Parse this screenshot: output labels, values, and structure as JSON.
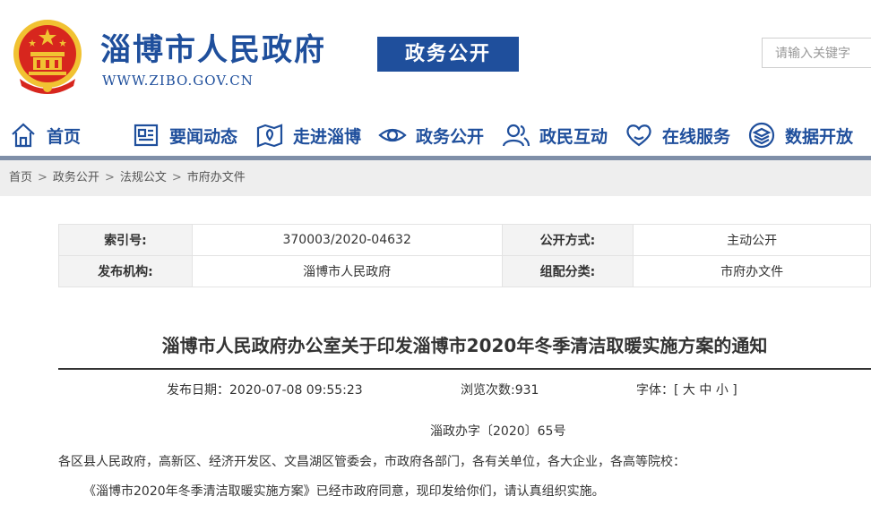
{
  "site": {
    "title": "淄博市人民政府",
    "url": "WWW.ZIBO.GOV.CN",
    "badge": "政务公开",
    "search_placeholder": "请输入关键字"
  },
  "nav": [
    {
      "label": "首页",
      "icon": "home-icon"
    },
    {
      "label": "要闻动态",
      "icon": "news-icon"
    },
    {
      "label": "走进淄博",
      "icon": "map-pin-icon"
    },
    {
      "label": "政务公开",
      "icon": "eye-icon"
    },
    {
      "label": "政民互动",
      "icon": "people-icon"
    },
    {
      "label": "在线服务",
      "icon": "heart-icon"
    },
    {
      "label": "数据开放",
      "icon": "layers-icon"
    }
  ],
  "breadcrumb": [
    "首页",
    "政务公开",
    "法规公文",
    "市府办文件"
  ],
  "meta": {
    "index_label": "索引号:",
    "index_value": "370003/2020-04632",
    "publish_mode_label": "公开方式:",
    "publish_mode_value": "主动公开",
    "issuer_label": "发布机构:",
    "issuer_value": "淄博市人民政府",
    "category_label": "组配分类:",
    "category_value": "市府办文件"
  },
  "article": {
    "title": "淄博市人民政府办公室关于印发淄博市2020年冬季清洁取暖实施方案的通知",
    "publish_date": "发布日期：2020-07-08 09:55:23",
    "views": "浏览次数:931",
    "font_label": "字体：[",
    "font_large": "大",
    "font_medium": "中",
    "font_small": "小",
    "font_close": "]",
    "doc_number": "淄政办字〔2020〕65号",
    "recipients": "各区县人民政府，高新区、经济开发区、文昌湖区管委会，市政府各部门，各有关单位，各大企业，各高等院校：",
    "body": "《淄博市2020年冬季清洁取暖实施方案》已经市政府同意，现印发给你们，请认真组织实施。"
  },
  "colors": {
    "brand_blue": "#1f4f9c",
    "nav_bar": "#7f8fa8",
    "emblem_red": "#d7261e",
    "emblem_gold": "#f1c232"
  }
}
